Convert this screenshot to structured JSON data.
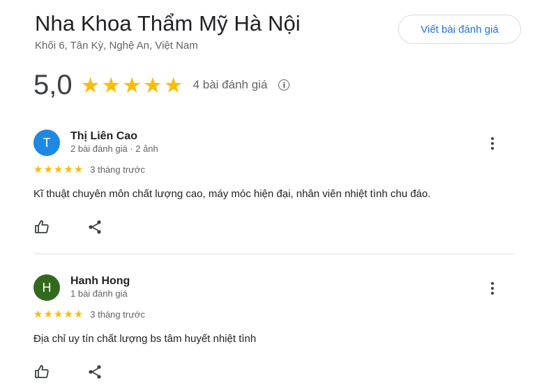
{
  "place": {
    "title": "Nha Khoa Thẩm Mỹ Hà Nội",
    "address": "Khối 6, Tân Kỳ, Nghệ An, Việt Nam"
  },
  "write_review_label": "Viết bài đánh giá",
  "summary": {
    "rating": "5,0",
    "stars": 5,
    "review_count": "4 bài đánh giá",
    "info_icon": "ⓘ"
  },
  "reviews": [
    {
      "avatar_letter": "T",
      "avatar_color": "#1e88e5",
      "name": "Thị Liên Cao",
      "meta": "2 bài đánh giá · 2 ảnh",
      "stars": 5,
      "time": "3 tháng trước",
      "text": "Kĩ thuật chuyên môn chất lượng cao, máy móc hiện đại, nhân viên nhiệt tình chu đáo."
    },
    {
      "avatar_letter": "H",
      "avatar_color": "#33691e",
      "name": "Hanh Hong",
      "meta": "1 bài đánh giá",
      "stars": 5,
      "time": "3 tháng trước",
      "text": "Địa chỉ uy tín chất lượng bs tâm huyết nhiệt tình"
    }
  ],
  "colors": {
    "accent": "#1a73e8",
    "star": "#fbbc04"
  }
}
